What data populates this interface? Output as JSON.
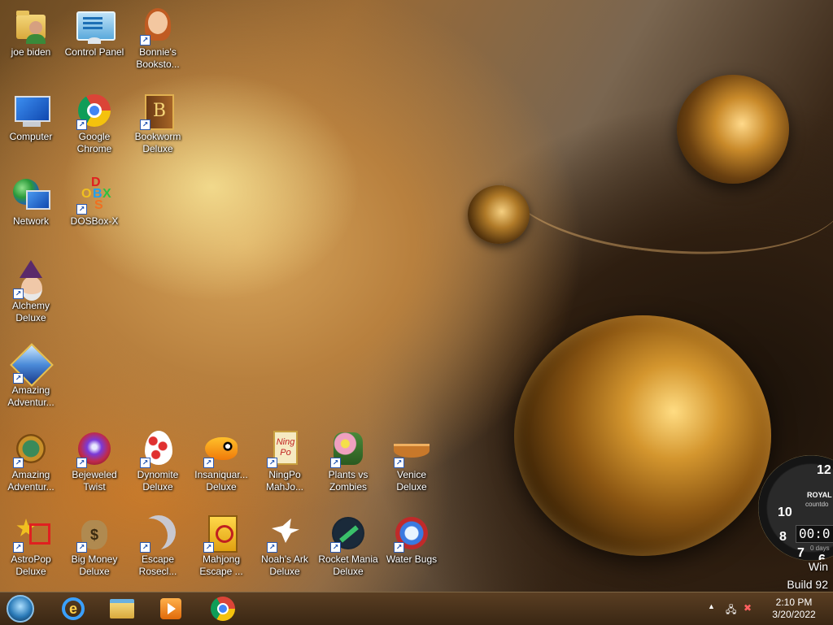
{
  "desktop": {
    "icons": [
      {
        "label": "joe biden",
        "icon": "user-folder-icon"
      },
      {
        "label": "Control Panel",
        "icon": "control-panel-icon"
      },
      {
        "label": "Bonnie's Booksto...",
        "icon": "bonnies-bookstore-icon"
      },
      {
        "label": "Computer",
        "icon": "computer-icon"
      },
      {
        "label": "Google Chrome",
        "icon": "chrome-icon"
      },
      {
        "label": "Bookworm Deluxe",
        "icon": "bookworm-icon"
      },
      {
        "label": "Network",
        "icon": "network-icon"
      },
      {
        "label": "DOSBox-X",
        "icon": "dosbox-icon"
      },
      {
        "label": "Alchemy Deluxe",
        "icon": "alchemy-icon"
      },
      {
        "label": "Amazing Adventur...",
        "icon": "amazing-adventures-icon"
      },
      {
        "label": "Amazing Adventur...",
        "icon": "amazing-adventures-2-icon"
      },
      {
        "label": "Bejeweled Twist",
        "icon": "bejeweled-icon"
      },
      {
        "label": "Dynomite Deluxe",
        "icon": "dynomite-icon"
      },
      {
        "label": "Insaniquar... Deluxe",
        "icon": "insaniquarium-icon"
      },
      {
        "label": "NingPo MahJo...",
        "icon": "ningpo-icon"
      },
      {
        "label": "Plants vs Zombies",
        "icon": "plants-vs-zombies-icon"
      },
      {
        "label": "Venice Deluxe",
        "icon": "venice-icon"
      },
      {
        "label": "AstroPop Deluxe",
        "icon": "astropop-icon"
      },
      {
        "label": "Big Money Deluxe",
        "icon": "big-money-icon"
      },
      {
        "label": "Escape Rosecl...",
        "icon": "escape-rosecliff-icon"
      },
      {
        "label": "Mahjong Escape ...",
        "icon": "mahjong-escape-icon"
      },
      {
        "label": "Noah's Ark Deluxe",
        "icon": "noahs-ark-icon"
      },
      {
        "label": "Rocket Mania Deluxe",
        "icon": "rocket-mania-icon"
      },
      {
        "label": "Water Bugs",
        "icon": "water-bugs-icon"
      }
    ],
    "ningpo_tile_text": "Ning Po",
    "dosbox_letters": [
      "D",
      "O",
      "B",
      "X",
      "S"
    ],
    "bookworm_letter": "B",
    "big_money_symbol": "$"
  },
  "gadget": {
    "brand": "ROYAL",
    "subtitle": "countdo",
    "digital": "00:0",
    "days": "0 days",
    "numbers": [
      "12",
      "10",
      "8",
      "7",
      "6"
    ]
  },
  "watermark": {
    "line1": "Win",
    "line2": "Build 92"
  },
  "taskbar": {
    "start": "start-orb-icon",
    "pinned": [
      "internet-explorer-icon",
      "file-explorer-icon",
      "media-player-icon",
      "chrome-icon"
    ],
    "ie_glyph": "e"
  },
  "tray": {
    "expand": "▲",
    "time": "2:10 PM",
    "date": "3/20/2022"
  }
}
